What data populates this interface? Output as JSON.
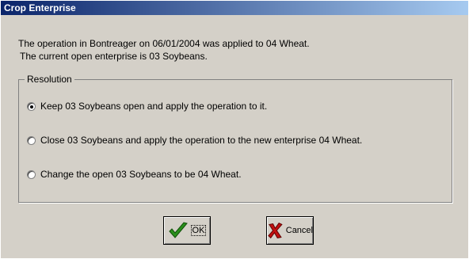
{
  "window": {
    "title": "Crop Enterprise"
  },
  "message": {
    "line1": "The operation in Bontreager on 06/01/2004 was applied to 04 Wheat.",
    "line2": "The current open enterprise is 03 Soybeans."
  },
  "resolution": {
    "label": "Resolution",
    "options": [
      {
        "label": "Keep 03 Soybeans open and apply the operation to it.",
        "selected": true
      },
      {
        "label": "Close 03 Soybeans and apply the operation to the new enterprise 04 Wheat.",
        "selected": false
      },
      {
        "label": "Change the open 03 Soybeans to be 04 Wheat.",
        "selected": false
      }
    ]
  },
  "buttons": {
    "ok": {
      "label": "OK",
      "icon": "checkmark-icon",
      "color": "#2a8f1c"
    },
    "cancel": {
      "label": "Cancel",
      "icon": "red-x-icon",
      "color": "#c01010"
    }
  }
}
